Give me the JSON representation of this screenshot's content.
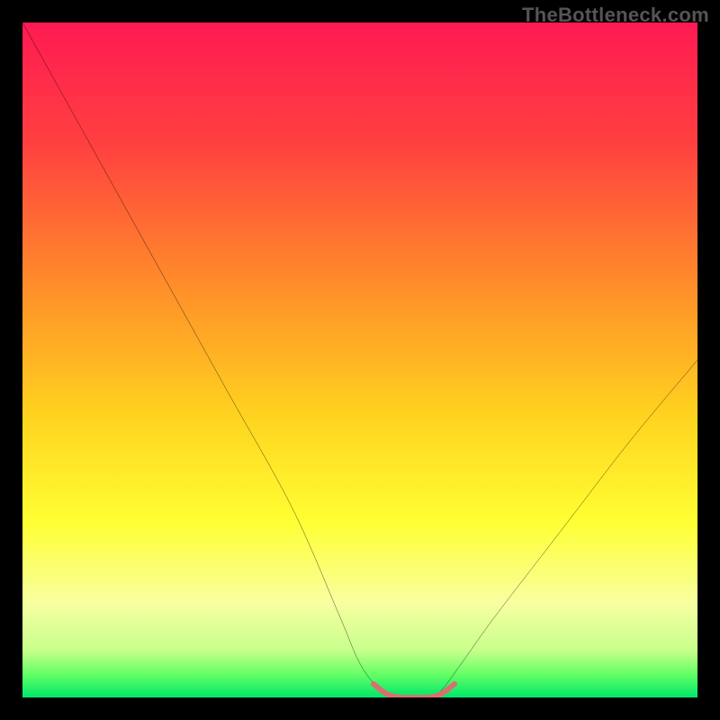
{
  "watermark": "TheBottleneck.com",
  "chart_data": {
    "type": "line",
    "title": "",
    "xlabel": "",
    "ylabel": "",
    "xlim": [
      0,
      100
    ],
    "ylim": [
      0,
      100
    ],
    "series": [
      {
        "name": "bottleneck-curve",
        "x": [
          0,
          10,
          20,
          30,
          40,
          47,
          50,
          53,
          55,
          58,
          60,
          62,
          65,
          70,
          80,
          90,
          100
        ],
        "values": [
          100,
          82,
          64,
          46,
          28,
          12,
          5,
          1,
          0,
          0,
          0,
          1,
          5,
          12,
          25,
          38,
          50
        ]
      },
      {
        "name": "optimal-band",
        "x": [
          52,
          54,
          56,
          58,
          60,
          62,
          64
        ],
        "values": [
          2,
          0.5,
          0,
          0,
          0,
          0.5,
          2
        ]
      }
    ],
    "gradient_stops": [
      {
        "offset": 0.0,
        "color": "#ff1a52"
      },
      {
        "offset": 0.18,
        "color": "#ff4040"
      },
      {
        "offset": 0.38,
        "color": "#ff8a2a"
      },
      {
        "offset": 0.58,
        "color": "#ffd21f"
      },
      {
        "offset": 0.74,
        "color": "#ffff33"
      },
      {
        "offset": 0.86,
        "color": "#f8ffa0"
      },
      {
        "offset": 0.93,
        "color": "#c8ff8c"
      },
      {
        "offset": 0.965,
        "color": "#66ff66"
      },
      {
        "offset": 1.0,
        "color": "#00e66b"
      }
    ],
    "colors": {
      "curve": "#000000",
      "optimal_band": "#d97070",
      "frame": "#000000"
    }
  }
}
